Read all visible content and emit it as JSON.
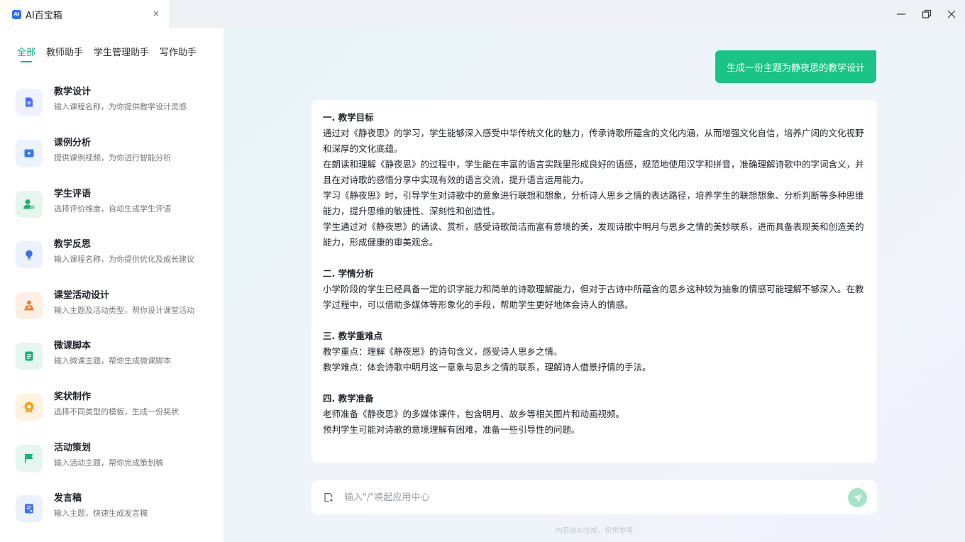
{
  "window": {
    "tab_title": "AI百宝箱",
    "logo_text": "AI",
    "close_tab_glyph": "×",
    "minimize_glyph": "—",
    "close_glyph": "✕"
  },
  "categories": [
    {
      "label": "全部",
      "active": true
    },
    {
      "label": "教师助手",
      "active": false
    },
    {
      "label": "学生管理助手",
      "active": false
    },
    {
      "label": "写作助手",
      "active": false
    }
  ],
  "tools": [
    {
      "title": "教学设计",
      "desc": "输入课程名称，为你提供教学设计灵感",
      "icon": "document-icon",
      "color": "#4a6cf7",
      "bg": "#eef1fe"
    },
    {
      "title": "课例分析",
      "desc": "提供课例视频，为你进行智能分析",
      "icon": "video-icon",
      "color": "#3778f0",
      "bg": "#ecf2fe"
    },
    {
      "title": "学生评语",
      "desc": "选择评价维度，自动生成学生评语",
      "icon": "user-comment-icon",
      "color": "#1fae6e",
      "bg": "#e6f6ee"
    },
    {
      "title": "教学反思",
      "desc": "输入课程名称，为你提供优化及成长建议",
      "icon": "lightbulb-icon",
      "color": "#3d6ff0",
      "bg": "#ecf1fe"
    },
    {
      "title": "课堂活动设计",
      "desc": "输入主题及活动类型，帮你设计课堂活动",
      "icon": "activity-icon",
      "color": "#f07d2c",
      "bg": "#fdefe4"
    },
    {
      "title": "微课脚本",
      "desc": "输入微课主题，帮你生成微课脚本",
      "icon": "script-icon",
      "color": "#19b277",
      "bg": "#e4f6ee"
    },
    {
      "title": "奖状制作",
      "desc": "选择不同类型的模板，生成一份奖状",
      "icon": "award-icon",
      "color": "#f5a21c",
      "bg": "#fef3e0"
    },
    {
      "title": "活动策划",
      "desc": "输入活动主题，帮你完成策划稿",
      "icon": "flag-icon",
      "color": "#19b277",
      "bg": "#e4f6ee"
    },
    {
      "title": "发言稿",
      "desc": "输入主题，快速生成发言稿",
      "icon": "speech-icon",
      "color": "#3d6ff0",
      "bg": "#ecf1fe"
    }
  ],
  "chat": {
    "user_message": "生成一份主题为静夜思的教学设计",
    "sections": [
      {
        "title": "一. 教学目标",
        "lines": [
          "通过对《静夜思》的学习，学生能够深入感受中华传统文化的魅力，传承诗歌所蕴含的文化内涵，从而增强文化自信，培养广阔的文化视野和深厚的文化底蕴。",
          "在朗读和理解《静夜思》的过程中，学生能在丰富的语言实践里形成良好的语感，规范地使用汉字和拼音，准确理解诗歌中的字词含义，并且在对诗歌的感悟分享中实现有效的语言交流，提升语言运用能力。",
          "学习《静夜思》时，引导学生对诗歌中的意象进行联想和想象，分析诗人思乡之情的表达路径，培养学生的联想想象、分析判断等多种思维能力，提升思维的敏捷性、深刻性和创造性。",
          "学生通过对《静夜思》的诵读、赏析，感受诗歌简洁而富有意境的美，发现诗歌中明月与思乡之情的美妙联系，进而具备表现美和创造美的能力，形成健康的审美观念。"
        ]
      },
      {
        "title": "二. 学情分析",
        "lines": [
          "小学阶段的学生已经具备一定的识字能力和简单的诗歌理解能力，但对于古诗中所蕴含的思乡这种较为抽象的情感可能理解不够深入。在教学过程中，可以借助多媒体等形象化的手段，帮助学生更好地体会诗人的情感。"
        ]
      },
      {
        "title": "三. 教学重难点",
        "lines": [
          "教学重点：理解《静夜思》的诗句含义，感受诗人思乡之情。",
          "教学难点：体会诗歌中明月这一意象与思乡之情的联系，理解诗人借景抒情的手法。"
        ]
      },
      {
        "title": "四. 教学准备",
        "lines": [
          "老师准备《静夜思》的多媒体课件，包含明月、故乡等相关图片和动画视频。",
          "预判学生可能对诗歌的意境理解有困难，准备一些引导性的问题。"
        ]
      }
    ],
    "input_placeholder": "输入\"/\"唤起应用中心",
    "footer_note": "内容由AI生成，仅供参考"
  },
  "colors": {
    "accent": "#10b97a",
    "user_bubble": "#1ac486",
    "send_button": "#a7e3c9"
  }
}
